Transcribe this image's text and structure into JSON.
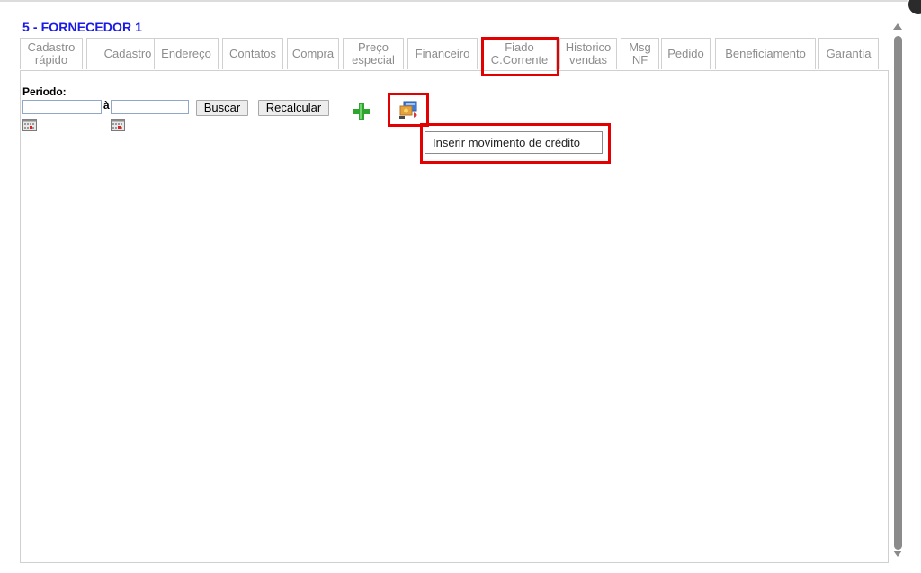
{
  "title": "5 - FORNECEDOR 1",
  "tabs": [
    {
      "label": "Cadastro\nrápido"
    },
    {
      "label": "Cadastro"
    },
    {
      "label": "Endereço"
    },
    {
      "label": "Contatos"
    },
    {
      "label": "Compra"
    },
    {
      "label": "Preço\nespecial"
    },
    {
      "label": "Financeiro"
    },
    {
      "label": "Fiado\nC.Corrente"
    },
    {
      "label": "Historico\nvendas"
    },
    {
      "label": "Msg\nNF"
    },
    {
      "label": "Pedido"
    },
    {
      "label": "Beneficiamento"
    },
    {
      "label": "Garantia"
    }
  ],
  "active_tab": "Fiado C.Corrente",
  "filter": {
    "periodo_label": "Periodo:",
    "separator": "à",
    "start_value": "",
    "end_value": "",
    "buscar_label": "Buscar",
    "recalcular_label": "Recalcular"
  },
  "tooltip": {
    "text": "Inserir movimento de crédito"
  },
  "colors": {
    "title": "#1a1ae6",
    "highlight": "#e20000",
    "tab_text": "#8c8c8c"
  }
}
